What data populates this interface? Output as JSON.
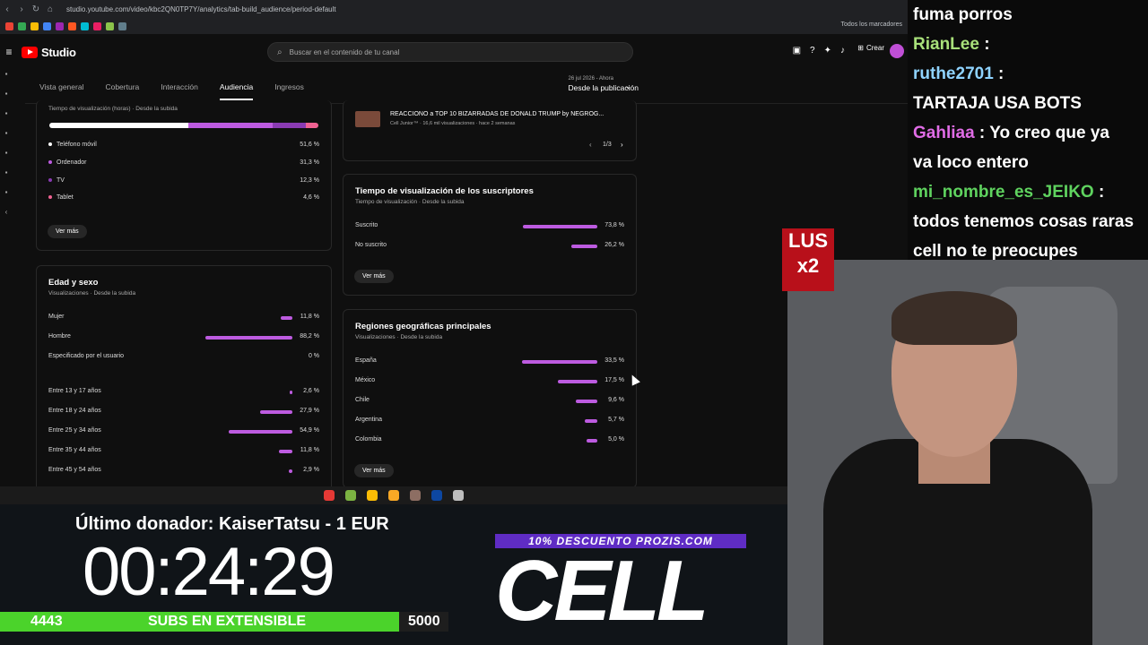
{
  "browser": {
    "url": "studio.youtube.com/video/kbc2QN0TP7Y/analytics/tab-build_audience/period-default",
    "bookmarks_folder": "Todos los marcadores"
  },
  "header": {
    "logo_text": "Studio",
    "search_placeholder": "Buscar en el contenido de tu canal",
    "create_label": "Crear"
  },
  "tabs": [
    "Vista general",
    "Cobertura",
    "Interacción",
    "Audiencia",
    "Ingresos"
  ],
  "date_range": {
    "small": "26 jul 2026 - Ahora",
    "main": "Desde la publicación"
  },
  "devices_card": {
    "subtitle": "Tiempo de visualización (horas) · Desde la subida",
    "items": [
      {
        "label": "Teléfono móvil",
        "value": "51,6 %",
        "color": "#ffffff"
      },
      {
        "label": "Ordenador",
        "value": "31,3 %",
        "color": "#bd5be0"
      },
      {
        "label": "TV",
        "value": "12,3 %",
        "color": "#8a3bb3"
      },
      {
        "label": "Tablet",
        "value": "4,6 %",
        "color": "#f06292"
      }
    ],
    "ver_mas": "Ver más"
  },
  "age_sex_card": {
    "title": "Edad y sexo",
    "subtitle": "Visualizaciones · Desde la subida",
    "sex": [
      {
        "label": "Mujer",
        "value": "11,8 %",
        "pct": 11.8
      },
      {
        "label": "Hombre",
        "value": "88,2 %",
        "pct": 88.2
      },
      {
        "label": "Especificado por el usuario",
        "value": "0 %",
        "pct": 0
      }
    ],
    "ages": [
      {
        "label": "Entre 13 y 17 años",
        "value": "2,6 %",
        "pct": 2.6
      },
      {
        "label": "Entre 18 y 24 años",
        "value": "27,9 %",
        "pct": 27.9
      },
      {
        "label": "Entre 25 y 34 años",
        "value": "54,9 %",
        "pct": 54.9
      },
      {
        "label": "Entre 35 y 44 años",
        "value": "11,8 %",
        "pct": 11.8
      },
      {
        "label": "Entre 45 y 54 años",
        "value": "2,9 %",
        "pct": 2.9
      }
    ]
  },
  "top_video": {
    "title": "REACCIONO a TOP 10 BIZARRADAS DE DONALD TRUMP by NEGROG...",
    "meta": "Cell Junior™ · 16,6 mil visualizaciones · hace 2 semanas",
    "pager": "1/3"
  },
  "subs_card": {
    "title": "Tiempo de visualización de los suscriptores",
    "subtitle": "Tiempo de visualización · Desde la subida",
    "items": [
      {
        "label": "Suscrito",
        "value": "73,8 %",
        "pct": 73.8
      },
      {
        "label": "No suscrito",
        "value": "26,2 %",
        "pct": 26.2
      }
    ],
    "ver_mas": "Ver más"
  },
  "regions_card": {
    "title": "Regiones geográficas principales",
    "subtitle": "Visualizaciones · Desde la subida",
    "items": [
      {
        "label": "España",
        "value": "33,5 %",
        "pct": 33.5
      },
      {
        "label": "México",
        "value": "17,5 %",
        "pct": 17.5
      },
      {
        "label": "Chile",
        "value": "9,6 %",
        "pct": 9.6
      },
      {
        "label": "Argentina",
        "value": "5,7 %",
        "pct": 5.7
      },
      {
        "label": "Colombia",
        "value": "5,0 %",
        "pct": 5.0
      }
    ],
    "ver_mas": "Ver más"
  },
  "stream_overlay": {
    "donor": "Último donador: KaiserTatsu - 1 EUR",
    "timer": "00:24:29",
    "subs_current": "4443",
    "subs_label": "SUBS EN EXTENSIBLE",
    "subs_goal": "5000",
    "subs_progress": 0.889,
    "promo": "10% DESCUENTO PROZIS.COM",
    "logo": "CELL",
    "badge_line1": "LUS",
    "badge_line2": "x2"
  },
  "chat": [
    {
      "name": "",
      "text": "fuma porros"
    },
    {
      "name": "RianLee",
      "text": " :"
    },
    {
      "name": "ruthe2701",
      "text": " :"
    },
    {
      "name": "",
      "text": "TARTAJA USA BOTS"
    },
    {
      "name": "Gahliaa",
      "text": " : Yo creo que ya"
    },
    {
      "name": "",
      "text": "va loco entero"
    },
    {
      "name": "mi_nombre_es_JEIKO",
      "text": " :"
    },
    {
      "name": "",
      "text": "todos tenemos cosas raras"
    },
    {
      "name": "",
      "text": "cell no te preocupes"
    }
  ],
  "colors": {
    "accent": "#bd5be0",
    "yt_red": "#ff0000",
    "subs_green": "#4bd32b",
    "promo_purple": "#5f2cc4"
  }
}
